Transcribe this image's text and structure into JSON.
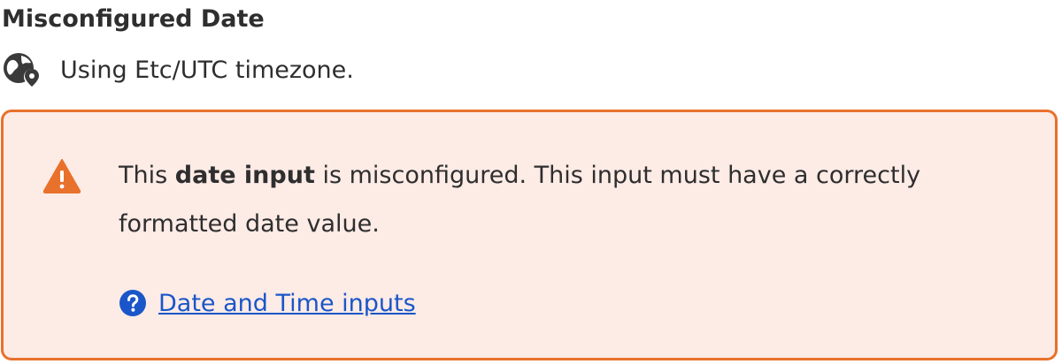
{
  "field": {
    "title": "Misconfigured Date"
  },
  "timezone": {
    "icon": "globe-location-icon",
    "text": "Using Etc/UTC timezone."
  },
  "alert": {
    "icon": "warning-icon",
    "message_prefix": "This ",
    "message_bold": "date input",
    "message_suffix": " is misconfigured. This input must have a correctly formatted date value.",
    "help_icon": "help-circle-icon",
    "help_link_label": "Date and Time inputs",
    "colors": {
      "border": "#e8712c",
      "background": "#fdebe6",
      "warning": "#e8712c",
      "link": "#1a56c9"
    }
  }
}
